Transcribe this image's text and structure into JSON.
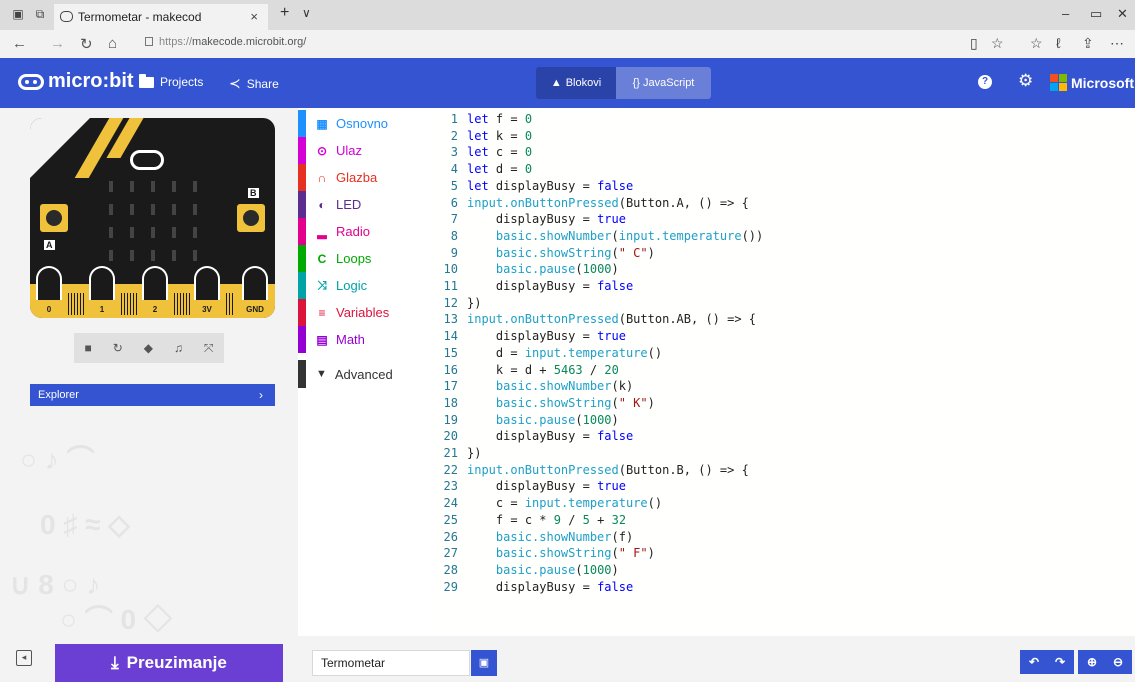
{
  "browser": {
    "tab_title": "Termometar - makecod",
    "tab_close": "×",
    "new_tab": "+",
    "tab_list": "∨",
    "url_scheme": "https://",
    "url_host": "makecode.microbit.org/",
    "icons": [
      "tab-preview-icon",
      "set-aside-icon",
      "back-icon",
      "forward-icon",
      "refresh-icon",
      "home-icon",
      "reading-view-icon",
      "favorite-star-icon",
      "favorites-hub-icon",
      "pen-icon",
      "share-icon",
      "more-icon"
    ]
  },
  "header": {
    "logo": "micro:bit",
    "projects_label": "Projects",
    "share_label": "Share",
    "blocks_label": "Blokovi",
    "js_label": "{} JavaScript",
    "microsoft_label": "Microsoft",
    "help_glyph": "?"
  },
  "simulator": {
    "pins": [
      "0",
      "1",
      "2",
      "3V",
      "GND"
    ],
    "button_a": "A",
    "button_b": "B",
    "explorer_label": "Explorer",
    "explorer_chevron": "›"
  },
  "toolbox": {
    "categories": [
      {
        "label": "Osnovno",
        "color": "#1e90ff"
      },
      {
        "label": "Ulaz",
        "color": "#d400d4"
      },
      {
        "label": "Glazba",
        "color": "#e63022"
      },
      {
        "label": "LED",
        "color": "#5c2d91"
      },
      {
        "label": "Radio",
        "color": "#e3008c"
      },
      {
        "label": "Loops",
        "color": "#00aa00"
      },
      {
        "label": "Logic",
        "color": "#00a4a6"
      },
      {
        "label": "Variables",
        "color": "#dc143c"
      },
      {
        "label": "Math",
        "color": "#9400d3"
      }
    ],
    "advanced_label": "Advanced"
  },
  "code": {
    "line_numbers": [
      "1",
      "2",
      "3",
      "4",
      "5",
      "6",
      "7",
      "8",
      "9",
      "10",
      "11",
      "12",
      "13",
      "14",
      "15",
      "16",
      "17",
      "18",
      "19",
      "20",
      "21",
      "22",
      "23",
      "24",
      "25",
      "26",
      "27",
      "28",
      "29"
    ],
    "lines": [
      "let f = 0",
      "let k = 0",
      "let c = 0",
      "let d = 0",
      "let displayBusy = false",
      "input.onButtonPressed(Button.A, () => {",
      "    displayBusy = true",
      "    basic.showNumber(input.temperature())",
      "    basic.showString(\" C\")",
      "    basic.pause(1000)",
      "    displayBusy = false",
      "})",
      "input.onButtonPressed(Button.AB, () => {",
      "    displayBusy = true",
      "    d = input.temperature()",
      "    k = d + 5463 / 20",
      "    basic.showNumber(k)",
      "    basic.showString(\" K\")",
      "    basic.pause(1000)",
      "    displayBusy = false",
      "})",
      "input.onButtonPressed(Button.B, () => {",
      "    displayBusy = true",
      "    c = input.temperature()",
      "    f = c * 9 / 5 + 32",
      "    basic.showNumber(f)",
      "    basic.showString(\" F\")",
      "    basic.pause(1000)",
      "    displayBusy = false"
    ]
  },
  "bottom": {
    "download_label": "Preuzimanje",
    "project_name": "Termometar"
  },
  "colors": {
    "header_bg": "#3454d1",
    "download_bg": "#6b3fd4",
    "board_yellow": "#f0c23c"
  }
}
